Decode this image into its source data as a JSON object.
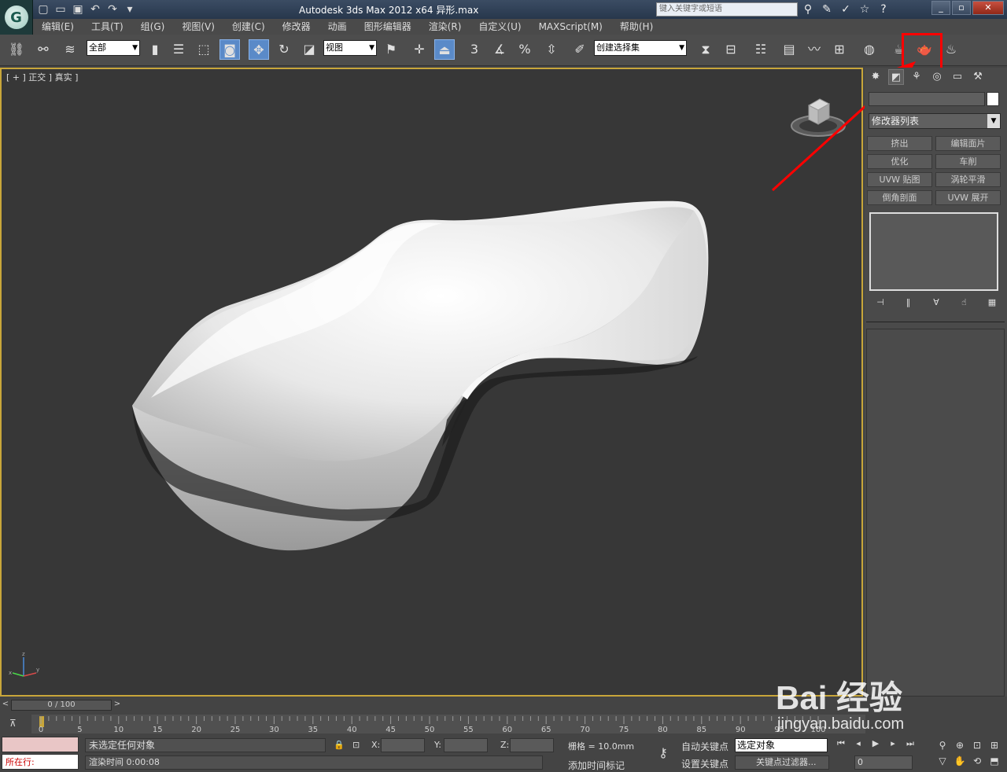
{
  "window": {
    "title": "Autodesk 3ds Max  2012 x64     异形.max",
    "search_placeholder": "键入关键字或短语"
  },
  "menu": [
    "编辑(E)",
    "工具(T)",
    "组(G)",
    "视图(V)",
    "创建(C)",
    "修改器",
    "动画",
    "图形编辑器",
    "渲染(R)",
    "自定义(U)",
    "MAXScript(M)",
    "帮助(H)"
  ],
  "toolbar": {
    "selection_filter": "全部",
    "ref_coord": "视图",
    "named_selection": "创建选择集",
    "snap_angle_label": "3"
  },
  "viewport": {
    "label": "[ + ] 正交 ] 真实 ]"
  },
  "command_panel": {
    "modifier_list": "修改器列表",
    "buttons": [
      "挤出",
      "编辑面片",
      "优化",
      "车削",
      "UVW 贴图",
      "涡轮平滑",
      "倒角剖面",
      "UVW 展开"
    ]
  },
  "timeline": {
    "frame_counter": "0 / 100",
    "ticks": [
      "0",
      "5",
      "10",
      "15",
      "20",
      "25",
      "30",
      "35",
      "40",
      "45",
      "50",
      "55",
      "60",
      "65",
      "70",
      "75",
      "80",
      "85",
      "90",
      "95",
      "100"
    ]
  },
  "status": {
    "maxscript_label": "所在行:",
    "selection_msg": "未选定任何对象",
    "render_time": "渲染时间  0:00:08",
    "coord_x": "X:",
    "coord_y": "Y:",
    "coord_z": "Z:",
    "grid": "栅格 = 10.0mm",
    "add_time_tag": "添加时间标记",
    "auto_key": "自动关键点",
    "set_key": "设置关键点",
    "selected_object": "选定对象",
    "key_filters": "关键点过滤器...",
    "current_frame": "0"
  },
  "watermark": {
    "brand": "Bai 经验",
    "url": "jingyan.baidu.com"
  },
  "colors": {
    "viewport_border": "#c8a63a",
    "highlight": "#ff0000",
    "active_button": "#5a8ac8"
  }
}
